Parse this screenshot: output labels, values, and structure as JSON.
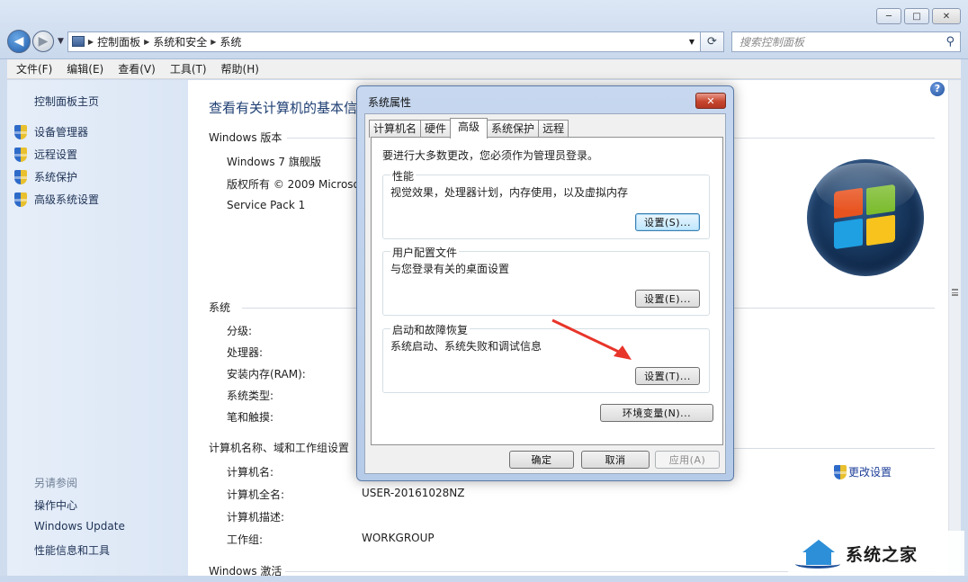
{
  "window": {
    "minimize": "─",
    "maximize": "□",
    "close": "✕"
  },
  "nav": {
    "breadcrumbs": [
      "控制面板",
      "系统和安全",
      "系统"
    ],
    "search_placeholder": "搜索控制面板"
  },
  "menu": [
    "文件(F)",
    "编辑(E)",
    "查看(V)",
    "工具(T)",
    "帮助(H)"
  ],
  "sidebar": {
    "home": "控制面板主页",
    "links": [
      "设备管理器",
      "远程设置",
      "系统保护",
      "高级系统设置"
    ],
    "see_also_title": "另请参阅",
    "see_also": [
      "操作中心",
      "Windows Update",
      "性能信息和工具"
    ]
  },
  "main": {
    "title": "查看有关计算机的基本信",
    "edition_header": "Windows 版本",
    "edition": "Windows 7 旗舰版",
    "copyright": "版权所有 © 2009 Microso",
    "service_pack": "Service Pack 1",
    "system_header": "系统",
    "system_labels": [
      "分级:",
      "处理器:",
      "安装内存(RAM):",
      "系统类型:",
      "笔和触摸:"
    ],
    "computer_header": "计算机名称、域和工作组设置",
    "computer_labels": [
      "计算机名:",
      "计算机全名:",
      "计算机描述:",
      "工作组:"
    ],
    "computer_fullname": "USER-20161028NZ",
    "workgroup": "WORKGROUP",
    "change_settings": "更改设置",
    "activation_header": "Windows 激活"
  },
  "dialog": {
    "title": "系统属性",
    "close": "✕",
    "tabs": [
      "计算机名",
      "硬件",
      "高级",
      "系统保护",
      "远程"
    ],
    "active_tab": "高级",
    "admin_note": "要进行大多数更改，您必须作为管理员登录。",
    "performance": {
      "title": "性能",
      "desc": "视觉效果，处理器计划，内存使用，以及虚拟内存",
      "button": "设置(S)..."
    },
    "user_profiles": {
      "title": "用户配置文件",
      "desc": "与您登录有关的桌面设置",
      "button": "设置(E)..."
    },
    "startup_recovery": {
      "title": "启动和故障恢复",
      "desc": "系统启动、系统失败和调试信息",
      "button": "设置(T)..."
    },
    "env_button": "环境变量(N)...",
    "ok": "确定",
    "cancel": "取消",
    "apply": "应用(A)"
  },
  "watermark": {
    "text": "系统之家"
  },
  "colors": {
    "arrow": "#e8352a",
    "link": "#1e3255",
    "title_blue": "#1e3f73"
  }
}
